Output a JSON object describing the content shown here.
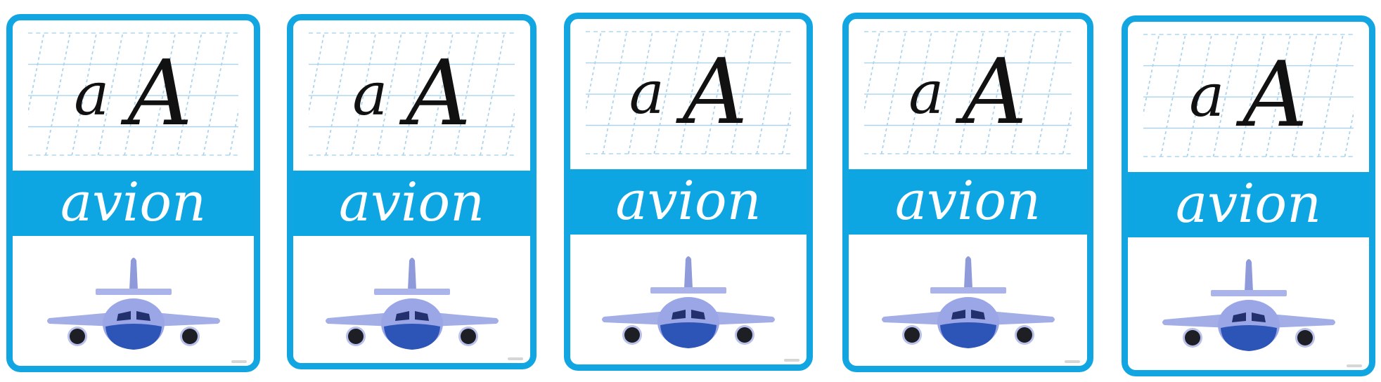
{
  "cards": [
    {
      "lowercase": "a",
      "uppercase": "A",
      "word": "avion",
      "image": "airplane-icon"
    },
    {
      "lowercase": "a",
      "uppercase": "A",
      "word": "avion",
      "image": "airplane-icon"
    },
    {
      "lowercase": "a",
      "uppercase": "A",
      "word": "avion",
      "image": "airplane-icon"
    },
    {
      "lowercase": "a",
      "uppercase": "A",
      "word": "avion",
      "image": "airplane-icon"
    },
    {
      "lowercase": "a",
      "uppercase": "A",
      "word": "avion",
      "image": "airplane-icon"
    }
  ],
  "colors": {
    "frame": "#11a6e1",
    "band": "#0ea6e2",
    "guide_lines": "#a9d3ee",
    "plane_body": "#9aa6e6",
    "plane_dark": "#2d55b7"
  }
}
